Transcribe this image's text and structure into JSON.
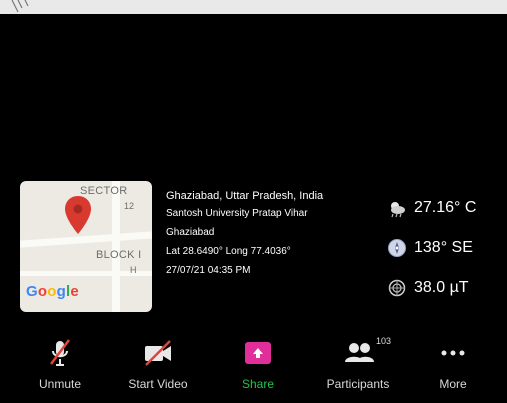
{
  "map": {
    "label_sector": "SECTOR",
    "label_12": "12",
    "label_block": "BLOCK I",
    "label_h": "H",
    "google_letters": [
      "G",
      "o",
      "o",
      "g",
      "l",
      "e"
    ],
    "google_colors": [
      "#4285F4",
      "#EA4335",
      "#FBBC05",
      "#4285F4",
      "#34A853",
      "#EA4335"
    ]
  },
  "geo": {
    "place": "Ghaziabad, Uttar Pradesh, India",
    "address": "Santosh University Pratap Vihar",
    "city": "Ghaziabad",
    "coords": "Lat 28.6490° Long 77.4036°",
    "datetime": "27/07/21 04:35 PM"
  },
  "sensors": [
    {
      "icon": "weather-icon",
      "value": "27.16° C"
    },
    {
      "icon": "compass-icon",
      "value": "138° SE"
    },
    {
      "icon": "magnetic-field-icon",
      "value": "38.0 µT"
    }
  ],
  "toolbar": {
    "unmute": "Unmute",
    "start_video": "Start Video",
    "share": "Share",
    "participants": "Participants",
    "participants_count": "103",
    "more": "More",
    "share_color": "#e02f9a",
    "share_label_color": "#27c04a",
    "mute_slash_color": "#e0443c"
  }
}
